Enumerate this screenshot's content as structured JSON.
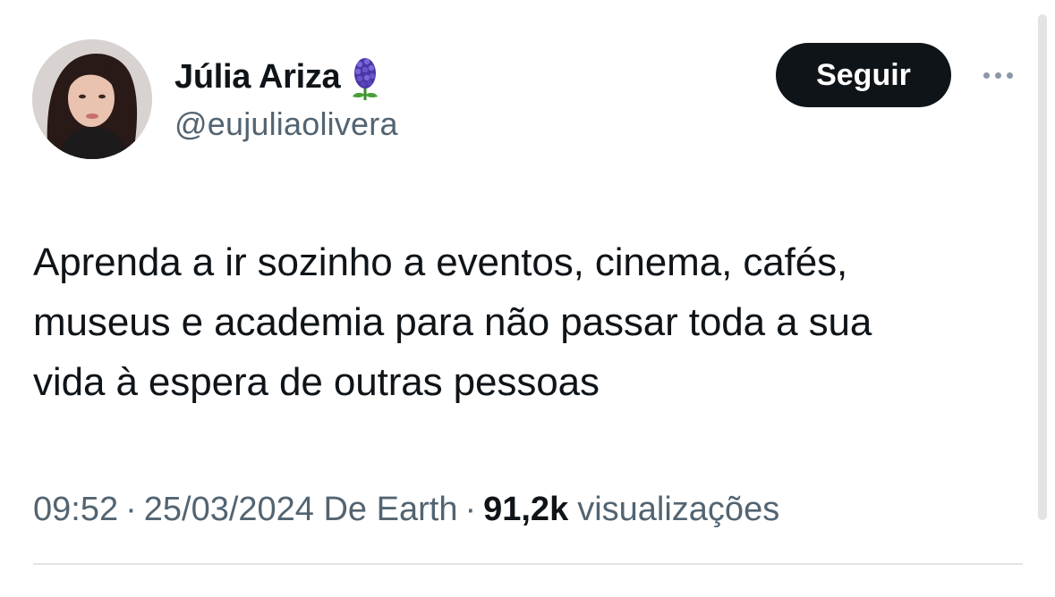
{
  "author": {
    "display_name": "Júlia Ariza",
    "handle": "@eujuliaolivera",
    "badge_icon": "hyacinth-icon"
  },
  "actions": {
    "follow_label": "Seguir",
    "more_icon": "more-horizontal-icon"
  },
  "tweet": {
    "text_lines": [
      "Aprenda a ir sozinho a eventos, cinema, cafés,",
      "museus e academia para não passar toda a sua",
      "vida à espera de outras pessoas"
    ]
  },
  "meta": {
    "time": "09:52",
    "separator": "·",
    "date_source": "25/03/2024 De Earth",
    "views_count": "91,2k",
    "views_label": "visualizações"
  },
  "colors": {
    "text_primary": "#0f1419",
    "text_secondary": "#536471",
    "follow_bg": "#0f1419",
    "badge_purple": "#5b3fb5"
  }
}
